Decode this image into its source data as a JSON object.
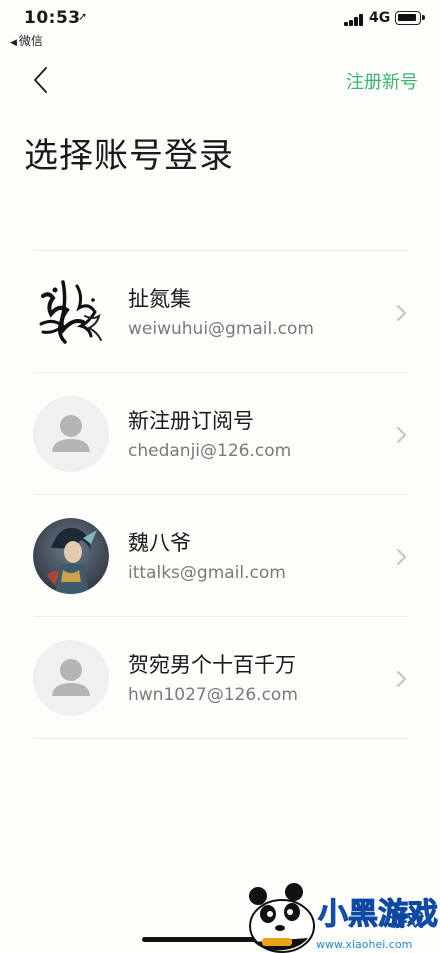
{
  "status_bar": {
    "time": "10:53",
    "network": "4G",
    "back_app": "微信"
  },
  "nav": {
    "register_label": "注册新号"
  },
  "page_title": "选择账号登录",
  "accounts": [
    {
      "name": "扯氮集",
      "email": "weiwuhui@gmail.com",
      "avatar": "calligraphy-logo"
    },
    {
      "name": "新注册订阅号",
      "email": "chedanji@126.com",
      "avatar": "default-person"
    },
    {
      "name": "魏八爷",
      "email": "ittalks@gmail.com",
      "avatar": "game-character"
    },
    {
      "name": "贺宛男个十百千万",
      "email": "hwn1027@126.com",
      "avatar": "default-person"
    }
  ],
  "watermark": {
    "brand": "小黑游戏",
    "url": "www.xiaohei.com"
  },
  "colors": {
    "accent": "#3cb371",
    "background": "#fdfdfa",
    "divider": "#ececec"
  }
}
